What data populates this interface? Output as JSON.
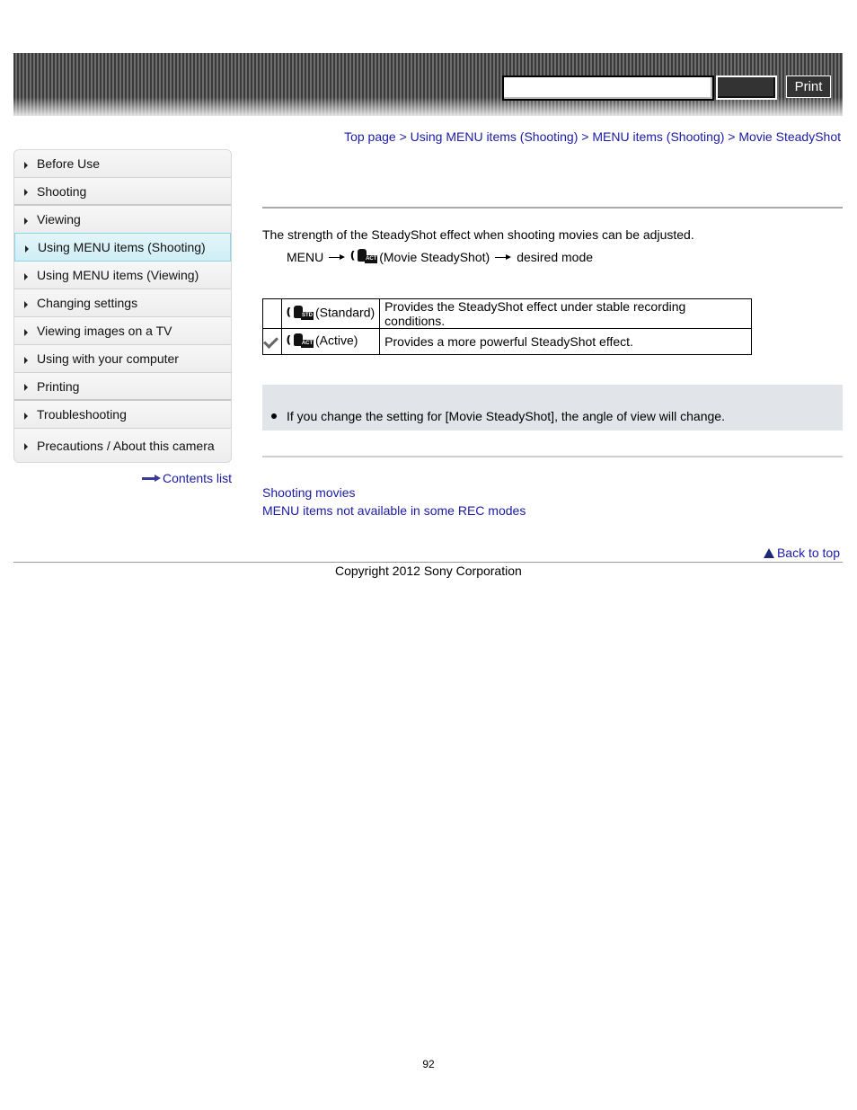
{
  "header": {
    "search_placeholder": "",
    "search_value": "",
    "search_button_label": "",
    "print_label": "Print"
  },
  "breadcrumb": {
    "items": [
      "Top page",
      "Using MENU items (Shooting)",
      "MENU items (Shooting)",
      "Movie SteadyShot"
    ],
    "separator": ">"
  },
  "sidebar": {
    "items": [
      {
        "label": "Before Use"
      },
      {
        "label": "Shooting"
      },
      {
        "label": "Viewing"
      },
      {
        "label": "Using MENU items (Shooting)",
        "active": true
      },
      {
        "label": "Using MENU items (Viewing)"
      },
      {
        "label": "Changing settings"
      },
      {
        "label": "Viewing images on a TV"
      },
      {
        "label": "Using with your computer"
      },
      {
        "label": "Printing"
      },
      {
        "label": "Troubleshooting"
      },
      {
        "label": "Precautions / About this camera"
      }
    ],
    "contents_link": "Contents list"
  },
  "main": {
    "intro": "The strength of the SteadyShot effect when shooting movies can be adjusted.",
    "menu_path": {
      "menu": "MENU",
      "icon": "movie-steadyshot-active-icon",
      "item": "(Movie SteadyShot)",
      "target": "desired mode"
    },
    "modes": [
      {
        "checked": false,
        "icon_badge": "STD",
        "name": "(Standard)",
        "description": "Provides the SteadyShot effect under stable recording conditions."
      },
      {
        "checked": true,
        "icon_badge": "ACT",
        "name": "(Active)",
        "description": "Provides a more powerful SteadyShot effect."
      }
    ],
    "note": "If you change the setting for [Movie SteadyShot], the angle of view will change.",
    "related_links": [
      "Shooting movies",
      "MENU items not available in some REC modes"
    ],
    "back_to_top": "Back to top"
  },
  "footer": {
    "copyright": "Copyright 2012 Sony Corporation",
    "page_number": "92"
  },
  "colors": {
    "link": "#1a1aa6",
    "active_nav_bg": "#d8f2f8",
    "note_bg": "#e1e4e8"
  }
}
